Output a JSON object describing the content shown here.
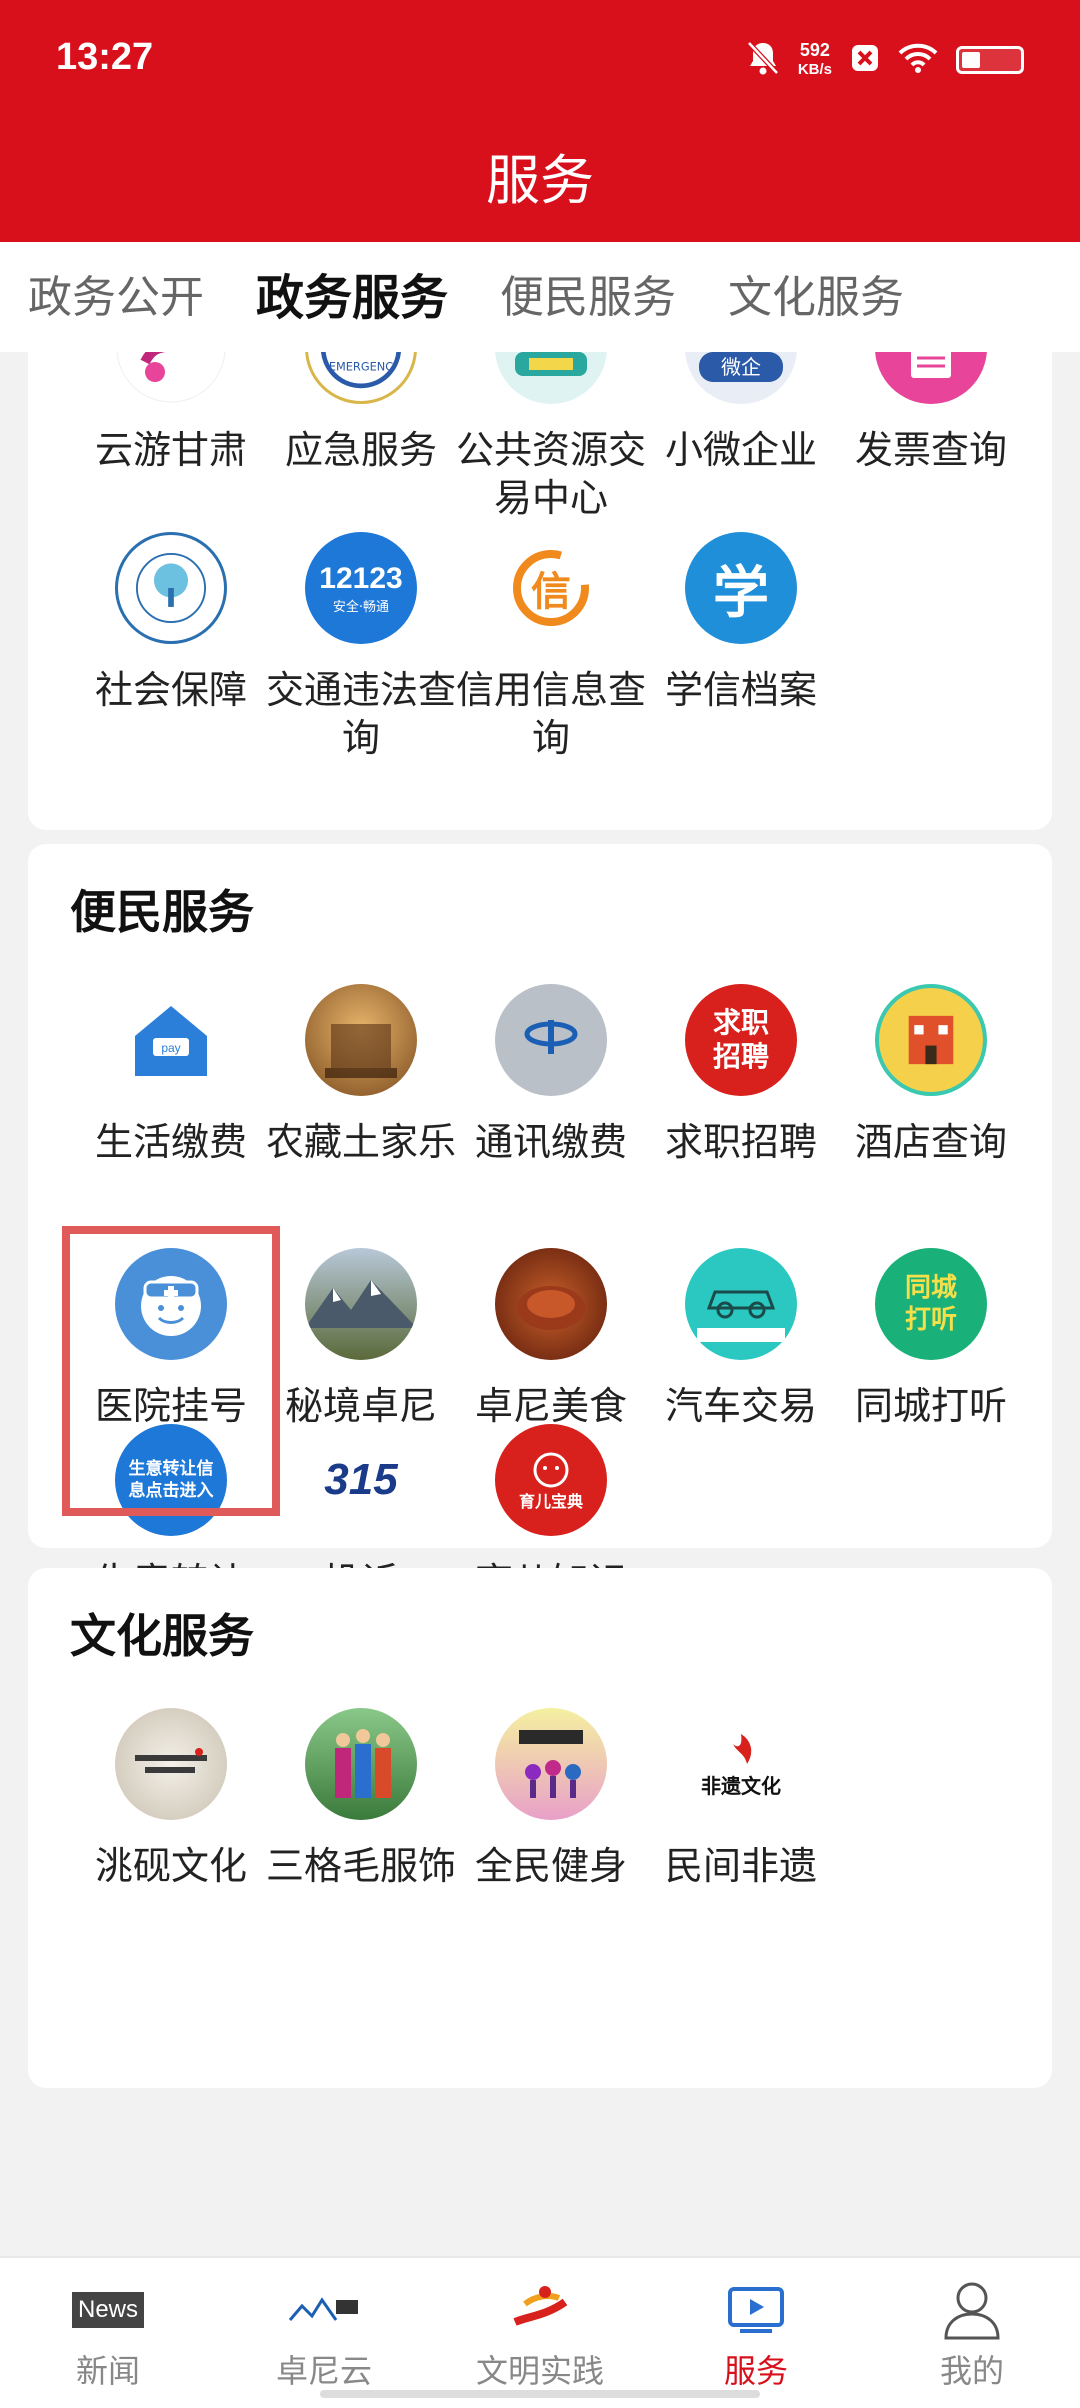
{
  "status": {
    "time": "13:27",
    "speed_value": "592",
    "speed_unit": "KB/s"
  },
  "header": {
    "title": "服务"
  },
  "tabs": [
    {
      "label": "政务公开"
    },
    {
      "label": "政务服务"
    },
    {
      "label": "便民服务"
    },
    {
      "label": "文化服务"
    }
  ],
  "gov": {
    "row1": [
      {
        "label": "云游甘肃",
        "icon": "tourism-logo-icon",
        "color": "#c0267a"
      },
      {
        "label": "应急服务",
        "icon": "emergency-badge-icon",
        "color": "#2a5aa8"
      },
      {
        "label": "公共资源交易中心",
        "icon": "public-resource-icon",
        "color": "#2aa8a0"
      },
      {
        "label": "小微企业",
        "icon": "micro-enterprise-icon",
        "color": "#2a5aa8"
      },
      {
        "label": "发票查询",
        "icon": "invoice-icon",
        "color": "#e8459a"
      }
    ],
    "row2": [
      {
        "label": "社会保障",
        "icon": "social-security-icon",
        "color": "#2a6fb0"
      },
      {
        "label": "交通违法查询",
        "icon": "traffic-12123-icon",
        "color": "#1e78d8",
        "badge": "12123",
        "sub": "安全·畅通"
      },
      {
        "label": "信用信息查询",
        "icon": "credit-icon",
        "color": "#f08a1c",
        "glyph": "信"
      },
      {
        "label": "学信档案",
        "icon": "student-archive-icon",
        "color": "#1e8fd8",
        "glyph": "学"
      }
    ]
  },
  "convenience": {
    "title": "便民服务",
    "row1": [
      {
        "label": "生活缴费",
        "icon": "house-pay-icon",
        "color": "#2b7fd8"
      },
      {
        "label": "农藏土家乐",
        "icon": "farmhouse-icon",
        "color": "#8a5a2a"
      },
      {
        "label": "通讯缴费",
        "icon": "china-telecom-icon",
        "color": "#9aa3ad"
      },
      {
        "label": "求职招聘",
        "icon": "job-recruit-icon",
        "color": "#d8201c",
        "glyph": "求职招聘"
      },
      {
        "label": "酒店查询",
        "icon": "hotel-icon",
        "color": "#3ac8b0"
      }
    ],
    "row2": [
      {
        "label": "医院挂号",
        "icon": "doctor-icon",
        "color": "#4a90d9"
      },
      {
        "label": "秘境卓尼",
        "icon": "mountain-photo-icon",
        "color": "#6a7b8c"
      },
      {
        "label": "卓尼美食",
        "icon": "food-photo-icon",
        "color": "#a03a20"
      },
      {
        "label": "汽车交易",
        "icon": "car-trade-icon",
        "color": "#2ac8c0"
      },
      {
        "label": "同城打听",
        "icon": "city-inquiry-icon",
        "color": "#1ab07a",
        "glyph": "同城打听"
      }
    ],
    "row3": [
      {
        "label": "生意转让",
        "icon": "business-transfer-icon",
        "color": "#1e78d8",
        "glyph": "生意转让信息点击进入"
      },
      {
        "label": "投诉",
        "icon": "complaint-315-icon",
        "color": "#1a3a8a",
        "glyph": "315"
      },
      {
        "label": "育儿知识",
        "icon": "parenting-icon",
        "color": "#d8201c",
        "glyph": "育儿宝典"
      }
    ]
  },
  "culture": {
    "title": "文化服务",
    "row1": [
      {
        "label": "洮砚文化",
        "icon": "inkstone-icon",
        "color": "#6a6a6a"
      },
      {
        "label": "三格毛服饰",
        "icon": "costume-photo-icon",
        "color": "#5a9a5a"
      },
      {
        "label": "全民健身",
        "icon": "fitness-icon",
        "color": "#c05ab0"
      },
      {
        "label": "民间非遗",
        "icon": "heritage-icon",
        "color": "#d8201c",
        "glyph": "非遗文化"
      }
    ]
  },
  "bottom_nav": [
    {
      "label": "新闻",
      "icon": "news-icon",
      "badge": "News"
    },
    {
      "label": "卓尼云",
      "icon": "cloud-logo-icon"
    },
    {
      "label": "文明实践",
      "icon": "civilization-icon"
    },
    {
      "label": "服务",
      "icon": "service-play-icon"
    },
    {
      "label": "我的",
      "icon": "profile-icon"
    }
  ]
}
